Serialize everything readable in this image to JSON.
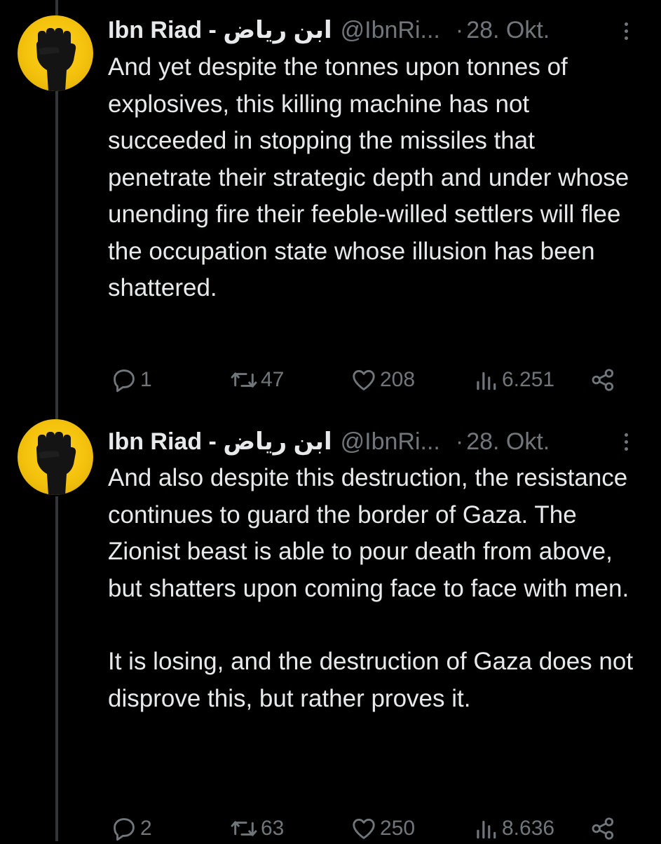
{
  "tweets": [
    {
      "author_name": "Ibn Riad - ابن رياض",
      "handle": "@IbnRi...",
      "separator": "·",
      "date": "28. Okt.",
      "text": [
        "And yet despite the tonnes upon tonnes of explosives, this killing machine has not succeeded in stopping the missiles that penetrate their strategic depth and under whose unending fire their feeble-willed settlers will flee the occupation state whose illusion has been shattered."
      ],
      "replies": "1",
      "reposts": "47",
      "likes": "208",
      "views": "6.251"
    },
    {
      "author_name": "Ibn Riad - ابن رياض",
      "handle": "@IbnRi...",
      "separator": "·",
      "date": "28. Okt.",
      "text": [
        "And also despite this destruction, the resistance continues to guard the border of Gaza. The Zionist beast is able to pour death from above, but shatters upon coming face to face with men.",
        "It is losing, and the destruction of Gaza does not disprove this, but rather proves it."
      ],
      "replies": "2",
      "reposts": "63",
      "likes": "250",
      "views": "8.636"
    }
  ],
  "icons": {
    "avatar": "raised-fist-icon",
    "more": "more-options-icon",
    "reply": "reply-icon",
    "repost": "repost-icon",
    "like": "heart-icon",
    "views": "views-icon",
    "share": "share-icon"
  },
  "colors": {
    "background": "#000000",
    "text_primary": "#e7e9ea",
    "text_secondary": "#71767b",
    "avatar_yellow": "#f4c20d",
    "thread_line": "#333639"
  }
}
